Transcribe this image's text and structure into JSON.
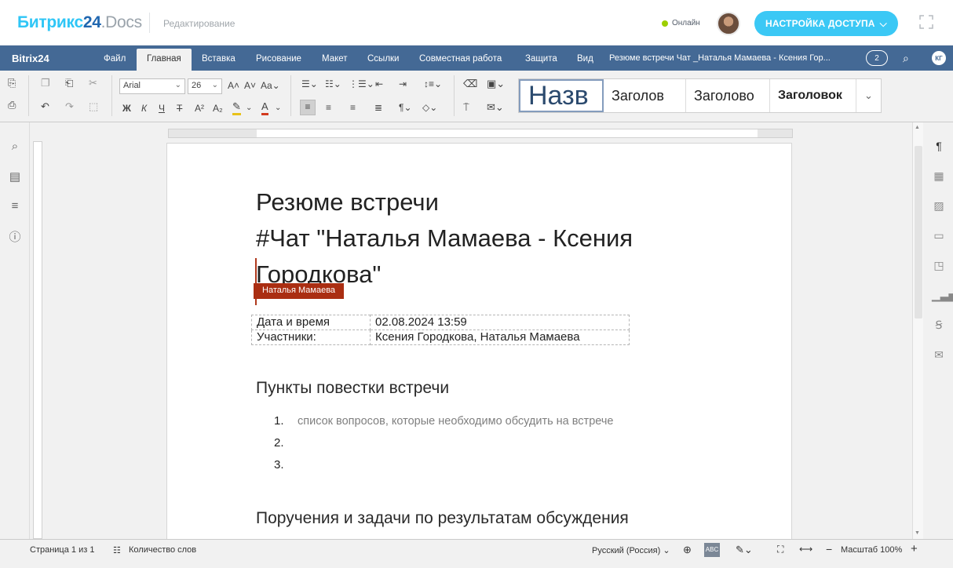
{
  "header": {
    "logo_main": "Битрикс",
    "logo_num": "24",
    "logo_docs": ".Docs",
    "mode": "Редактирование",
    "online_label": "Онлайн",
    "access_button": "НАСТРОЙКА ДОСТУПА",
    "accent_color": "#3bc8f5"
  },
  "menubar": {
    "brand": "Bitrix24",
    "items": [
      "Файл",
      "Главная",
      "Вставка",
      "Рисование",
      "Макет",
      "Ссылки",
      "Совместная работа",
      "Защита",
      "Вид"
    ],
    "active_item": "Главная",
    "doc_title": "Резюме встречи Чат _Наталья Мамаева - Ксения Гор...",
    "users_count": "2",
    "user_initials": "КГ",
    "bg_color": "#446995"
  },
  "toolbar": {
    "font_name": "Arial",
    "font_size": "26",
    "styles": [
      "Назв",
      "Заголов",
      "Заголово",
      "Заголовок"
    ]
  },
  "document": {
    "title_line1": "Резюме встречи",
    "title_line2": "#Чат \"Наталья Мамаева - Ксения",
    "title_line3": "Городкова\"",
    "author_tag": "Наталья Мамаева",
    "meta": [
      {
        "label": "Дата и время",
        "value": "02.08.2024 13:59"
      },
      {
        "label": "Участники:",
        "value": "Ксения Городкова, Наталья Мамаева"
      }
    ],
    "agenda_heading": "Пункты повестки встречи",
    "agenda_items": [
      {
        "num": "1.",
        "text": "список вопросов, которые необходимо обсудить на встрече"
      },
      {
        "num": "2.",
        "text": ""
      },
      {
        "num": "3.",
        "text": ""
      }
    ],
    "tasks_heading": "Поручения и задачи по результатам обсуждения"
  },
  "statusbar": {
    "page": "Страница 1 из 1",
    "word_count": "Количество слов",
    "language": "Русский (Россия)",
    "zoom": "Масштаб 100%"
  }
}
